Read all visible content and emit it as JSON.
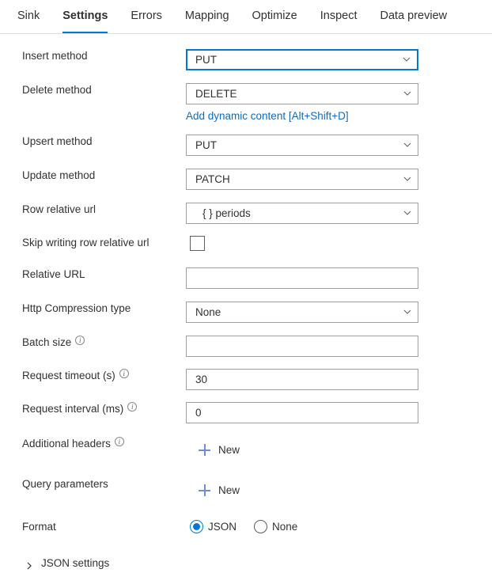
{
  "tabs": [
    {
      "label": "Sink",
      "active": false
    },
    {
      "label": "Settings",
      "active": true
    },
    {
      "label": "Errors",
      "active": false
    },
    {
      "label": "Mapping",
      "active": false
    },
    {
      "label": "Optimize",
      "active": false
    },
    {
      "label": "Inspect",
      "active": false
    },
    {
      "label": "Data preview",
      "active": false
    }
  ],
  "colors": {
    "accent": "#0078d4",
    "link": "#0f6cbd",
    "border": "#a19f9d",
    "text": "#323130",
    "plus": "#6e8fd6"
  },
  "fields": {
    "insert_method": {
      "label": "Insert method",
      "value": "PUT",
      "placeholder": ""
    },
    "delete_method": {
      "label": "Delete method",
      "value": "DELETE",
      "placeholder": ""
    },
    "dynamic_content_link": "Add dynamic content [Alt+Shift+D]",
    "upsert_method": {
      "label": "Upsert method",
      "value": "PUT",
      "placeholder": ""
    },
    "update_method": {
      "label": "Update method",
      "value": "PATCH",
      "placeholder": ""
    },
    "row_relative_url": {
      "label": "Row relative url",
      "value": "{ } periods",
      "placeholder": ""
    },
    "skip_writing_row_relative_url": {
      "label": "Skip writing row relative url",
      "checked": false
    },
    "relative_url": {
      "label": "Relative URL",
      "value": "",
      "placeholder": ""
    },
    "http_compression_type": {
      "label": "Http Compression type",
      "value": "None",
      "placeholder": ""
    },
    "batch_size": {
      "label": "Batch size",
      "value": "",
      "placeholder": ""
    },
    "request_timeout": {
      "label": "Request timeout (s)",
      "value": "30",
      "placeholder": ""
    },
    "request_interval": {
      "label": "Request interval (ms)",
      "value": "0",
      "placeholder": ""
    },
    "additional_headers": {
      "label": "Additional headers",
      "new_label": "New"
    },
    "query_parameters": {
      "label": "Query parameters",
      "new_label": "New"
    },
    "format": {
      "label": "Format",
      "options": [
        {
          "label": "JSON",
          "selected": true
        },
        {
          "label": "None",
          "selected": false
        }
      ]
    },
    "json_settings": {
      "label": "JSON settings",
      "expanded": false
    }
  }
}
